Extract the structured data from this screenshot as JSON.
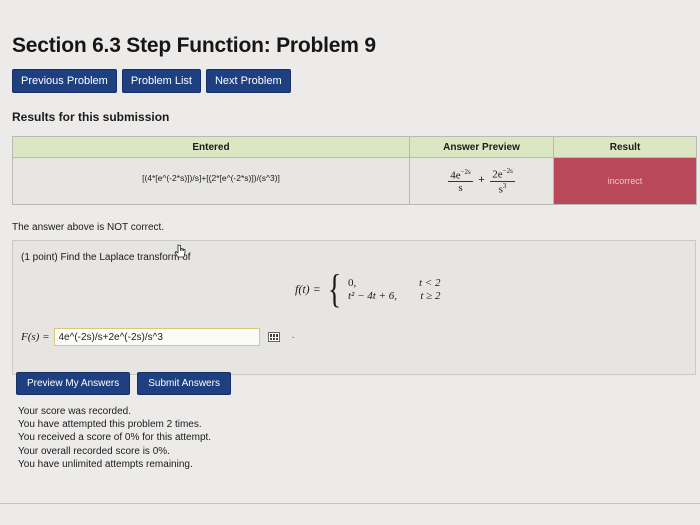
{
  "title": "Section 6.3 Step Function: Problem 9",
  "nav": {
    "previous": "Previous Problem",
    "list": "Problem List",
    "next": "Next Problem"
  },
  "results": {
    "heading": "Results for this submission",
    "headers": {
      "entered": "Entered",
      "preview": "Answer Preview",
      "result": "Result"
    },
    "entered": "[(4*[e^(-2*s)])/s]+[(2*[e^(-2*s)])/(s^3)]",
    "entered_mark": "˘",
    "preview": {
      "term1_num": "4e",
      "term1_exp": "−2s",
      "term1_den": "s",
      "plus": "+",
      "term2_num": "2e",
      "term2_exp": "−2s",
      "term2_den_base": "s",
      "term2_den_exp": "3"
    },
    "result": "incorrect",
    "result_color": "#b9485b"
  },
  "status_message": "The answer above is NOT correct.",
  "problem": {
    "statement": "(1 point) Find the Laplace transform of",
    "function_label": "f(t) =",
    "case1_value": "0,",
    "case1_condition": "t < 2",
    "case2_value": "t² − 4t + 6,",
    "case2_condition": "t ≥ 2",
    "answer_label": "F(s) =",
    "answer_value": "4e^(-2s)/s+2e^(-2s)/s^3"
  },
  "actions": {
    "preview": "Preview My Answers",
    "submit": "Submit Answers"
  },
  "score": {
    "line1": "Your score was recorded.",
    "line2": "You have attempted this problem 2 times.",
    "line3": "You received a score of 0% for this attempt.",
    "line4": "Your overall recorded score is 0%.",
    "line5": "You have unlimited attempts remaining."
  },
  "colors": {
    "button": "#1e3f80",
    "header_bg": "#dbe6c3",
    "page_bg": "#ecebea"
  },
  "icons": [
    "matrix-icon",
    "hand-cursor-icon",
    "dot-icon"
  ]
}
